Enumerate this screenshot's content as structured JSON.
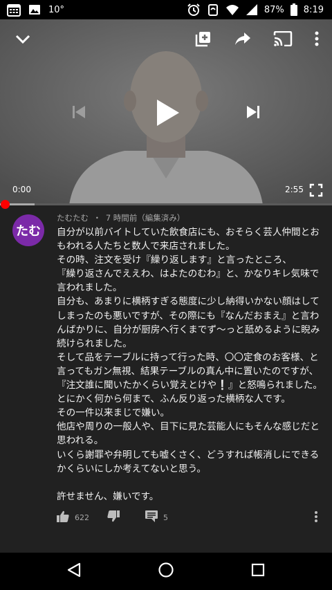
{
  "status_bar": {
    "temperature": "10°",
    "battery": "87%",
    "time": "8:19"
  },
  "player": {
    "current_time": "0:00",
    "duration": "2:55",
    "progress": 0.0
  },
  "comment": {
    "avatar_text": "たむ",
    "author": "たむたむ",
    "separator": "・",
    "posted": "7 時間前（編集済み）",
    "lines": [
      "自分が以前バイトしていた飲食店にも、おそらく芸人仲間とお",
      "もわれる人たちと数人で来店されました。",
      "その時、注文を受け『繰り返します』と言ったところ、",
      "『繰り返さんでええわ、はよたのむわ』と、かなりキレ気味で",
      "言われました。",
      "自分も、あまりに横柄すぎる態度に少し納得いかない顔はして",
      "しまったのも悪いですが、その際にも『なんだおまえ』と言わ",
      "んばかりに、自分が厨房へ行くまでず〜っと舐めるように睨み",
      "続けられました。",
      "そして品をテーブルに持って行った時、〇〇定食のお客様、と",
      "言ってもガン無視、結果テーブルの真ん中に置いたのですが、",
      "『注文誰に聞いたかくらい覚えとけや❕』と怒鳴られました。",
      "とにかく何から何まで、ふん反り返った横柄な人です。",
      "その一件以来まじで嫌い。",
      "他店や周りの一般人や、目下に見た芸能人にもそんな感じだと",
      "思われる。",
      "いくら謝罪や弁明しても嘘くさく、どうすれば帳消しにできる",
      "かくらいにしか考えてないと思う。",
      "",
      "許せません、嫌いです。"
    ],
    "like_count": "622",
    "reply_count": "5"
  }
}
